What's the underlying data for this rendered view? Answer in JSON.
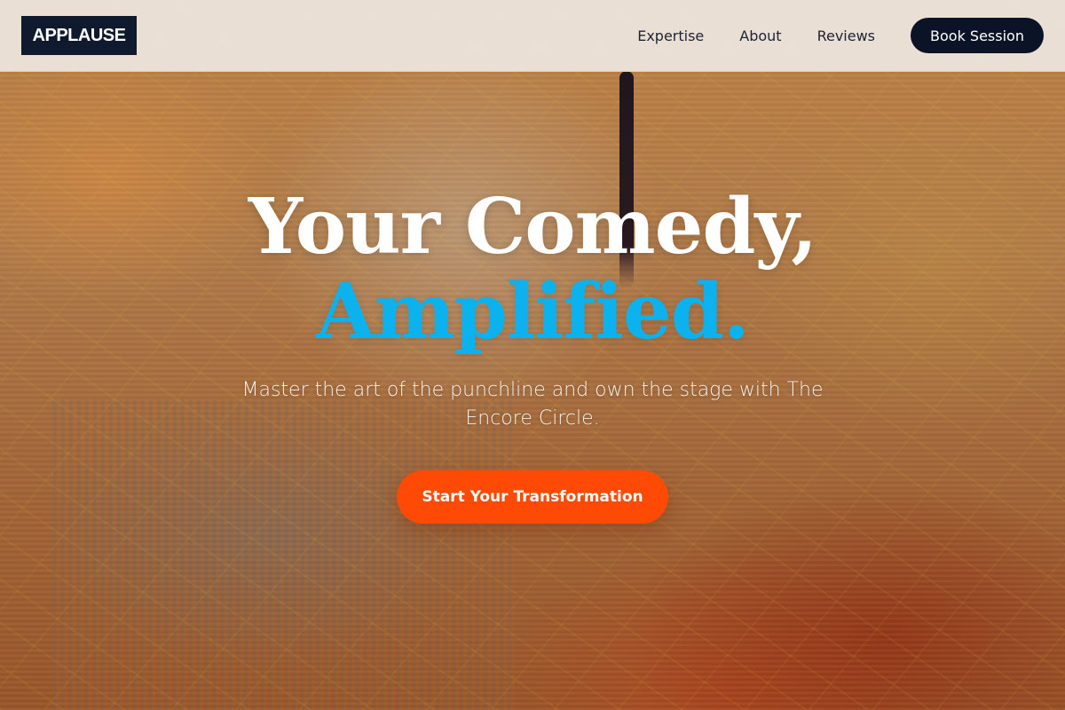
{
  "brand": {
    "logo_text": "APPLAUSE"
  },
  "nav": {
    "items": [
      {
        "label": "Expertise"
      },
      {
        "label": "About"
      },
      {
        "label": "Reviews"
      }
    ],
    "cta_label": "Book Session"
  },
  "hero": {
    "headline_line1": "Your Comedy,",
    "headline_line2": "Amplified.",
    "subheadline": "Master the art of the punchline and own the stage with The Encore Circle.",
    "cta_label": "Start Your Transformation"
  },
  "colors": {
    "logo_bg": "#0f1a2e",
    "accent_blue": "#0bb2ee",
    "cta_orange": "#ff4a06",
    "nav_cta_bg": "#0b1426"
  }
}
